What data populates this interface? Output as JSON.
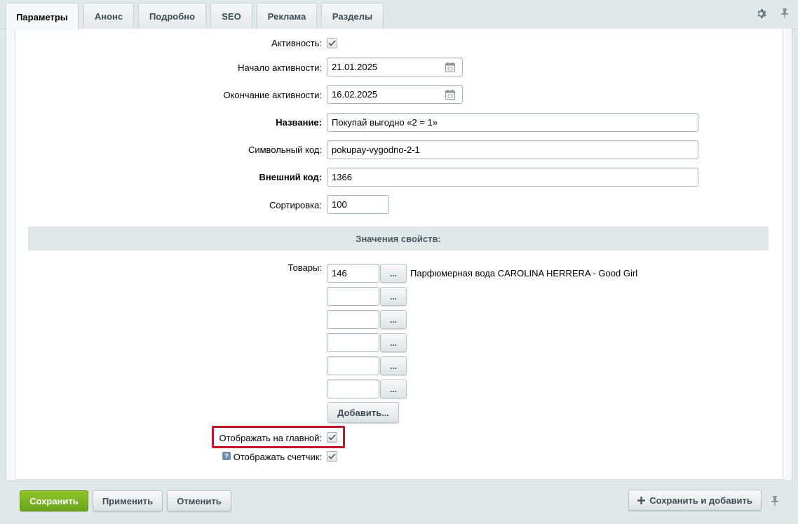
{
  "tabs": [
    {
      "label": "Параметры",
      "active": true
    },
    {
      "label": "Анонс",
      "active": false
    },
    {
      "label": "Подробно",
      "active": false
    },
    {
      "label": "SEO",
      "active": false
    },
    {
      "label": "Реклама",
      "active": false
    },
    {
      "label": "Разделы",
      "active": false
    }
  ],
  "tab_tools": {
    "settings_icon": "gear-icon",
    "pin_icon": "pin-icon"
  },
  "form": {
    "active": {
      "label": "Активность:",
      "checked": true
    },
    "active_from": {
      "label": "Начало активности:",
      "value": "21.01.2025",
      "icon": "calendar-icon"
    },
    "active_to": {
      "label": "Окончание активности:",
      "value": "16.02.2025",
      "icon": "calendar-icon"
    },
    "name": {
      "label": "Название:",
      "value": "Покупай выгодно «2 = 1»"
    },
    "code": {
      "label": "Символьный код:",
      "value": "pokupay-vygodno-2-1"
    },
    "xml_id": {
      "label": "Внешний код:",
      "value": "1366"
    },
    "sort": {
      "label": "Сортировка:",
      "value": "100"
    }
  },
  "properties": {
    "section_title": "Значения свойств:",
    "products": {
      "label": "Товары:",
      "rows": [
        {
          "value": "146",
          "description": "Парфюмерная вода CAROLINA HERRERA - Good Girl"
        },
        {
          "value": "",
          "description": ""
        },
        {
          "value": "",
          "description": ""
        },
        {
          "value": "",
          "description": ""
        },
        {
          "value": "",
          "description": ""
        },
        {
          "value": "",
          "description": ""
        }
      ],
      "pick_label": "...",
      "add_label": "Добавить..."
    },
    "show_on_main": {
      "label": "Отображать на главной:",
      "checked": true
    },
    "show_counter": {
      "label": "Отображать счетчик:",
      "checked": true,
      "help_icon": "help-icon"
    }
  },
  "footer": {
    "save": "Сохранить",
    "apply": "Применить",
    "cancel": "Отменить",
    "save_and_add": "Сохранить и добавить",
    "pin_icon": "pin-icon"
  },
  "colors": {
    "accent_green": "#7ab51f",
    "highlight_red": "#c0142a",
    "section_bg": "#e0e8ea"
  }
}
